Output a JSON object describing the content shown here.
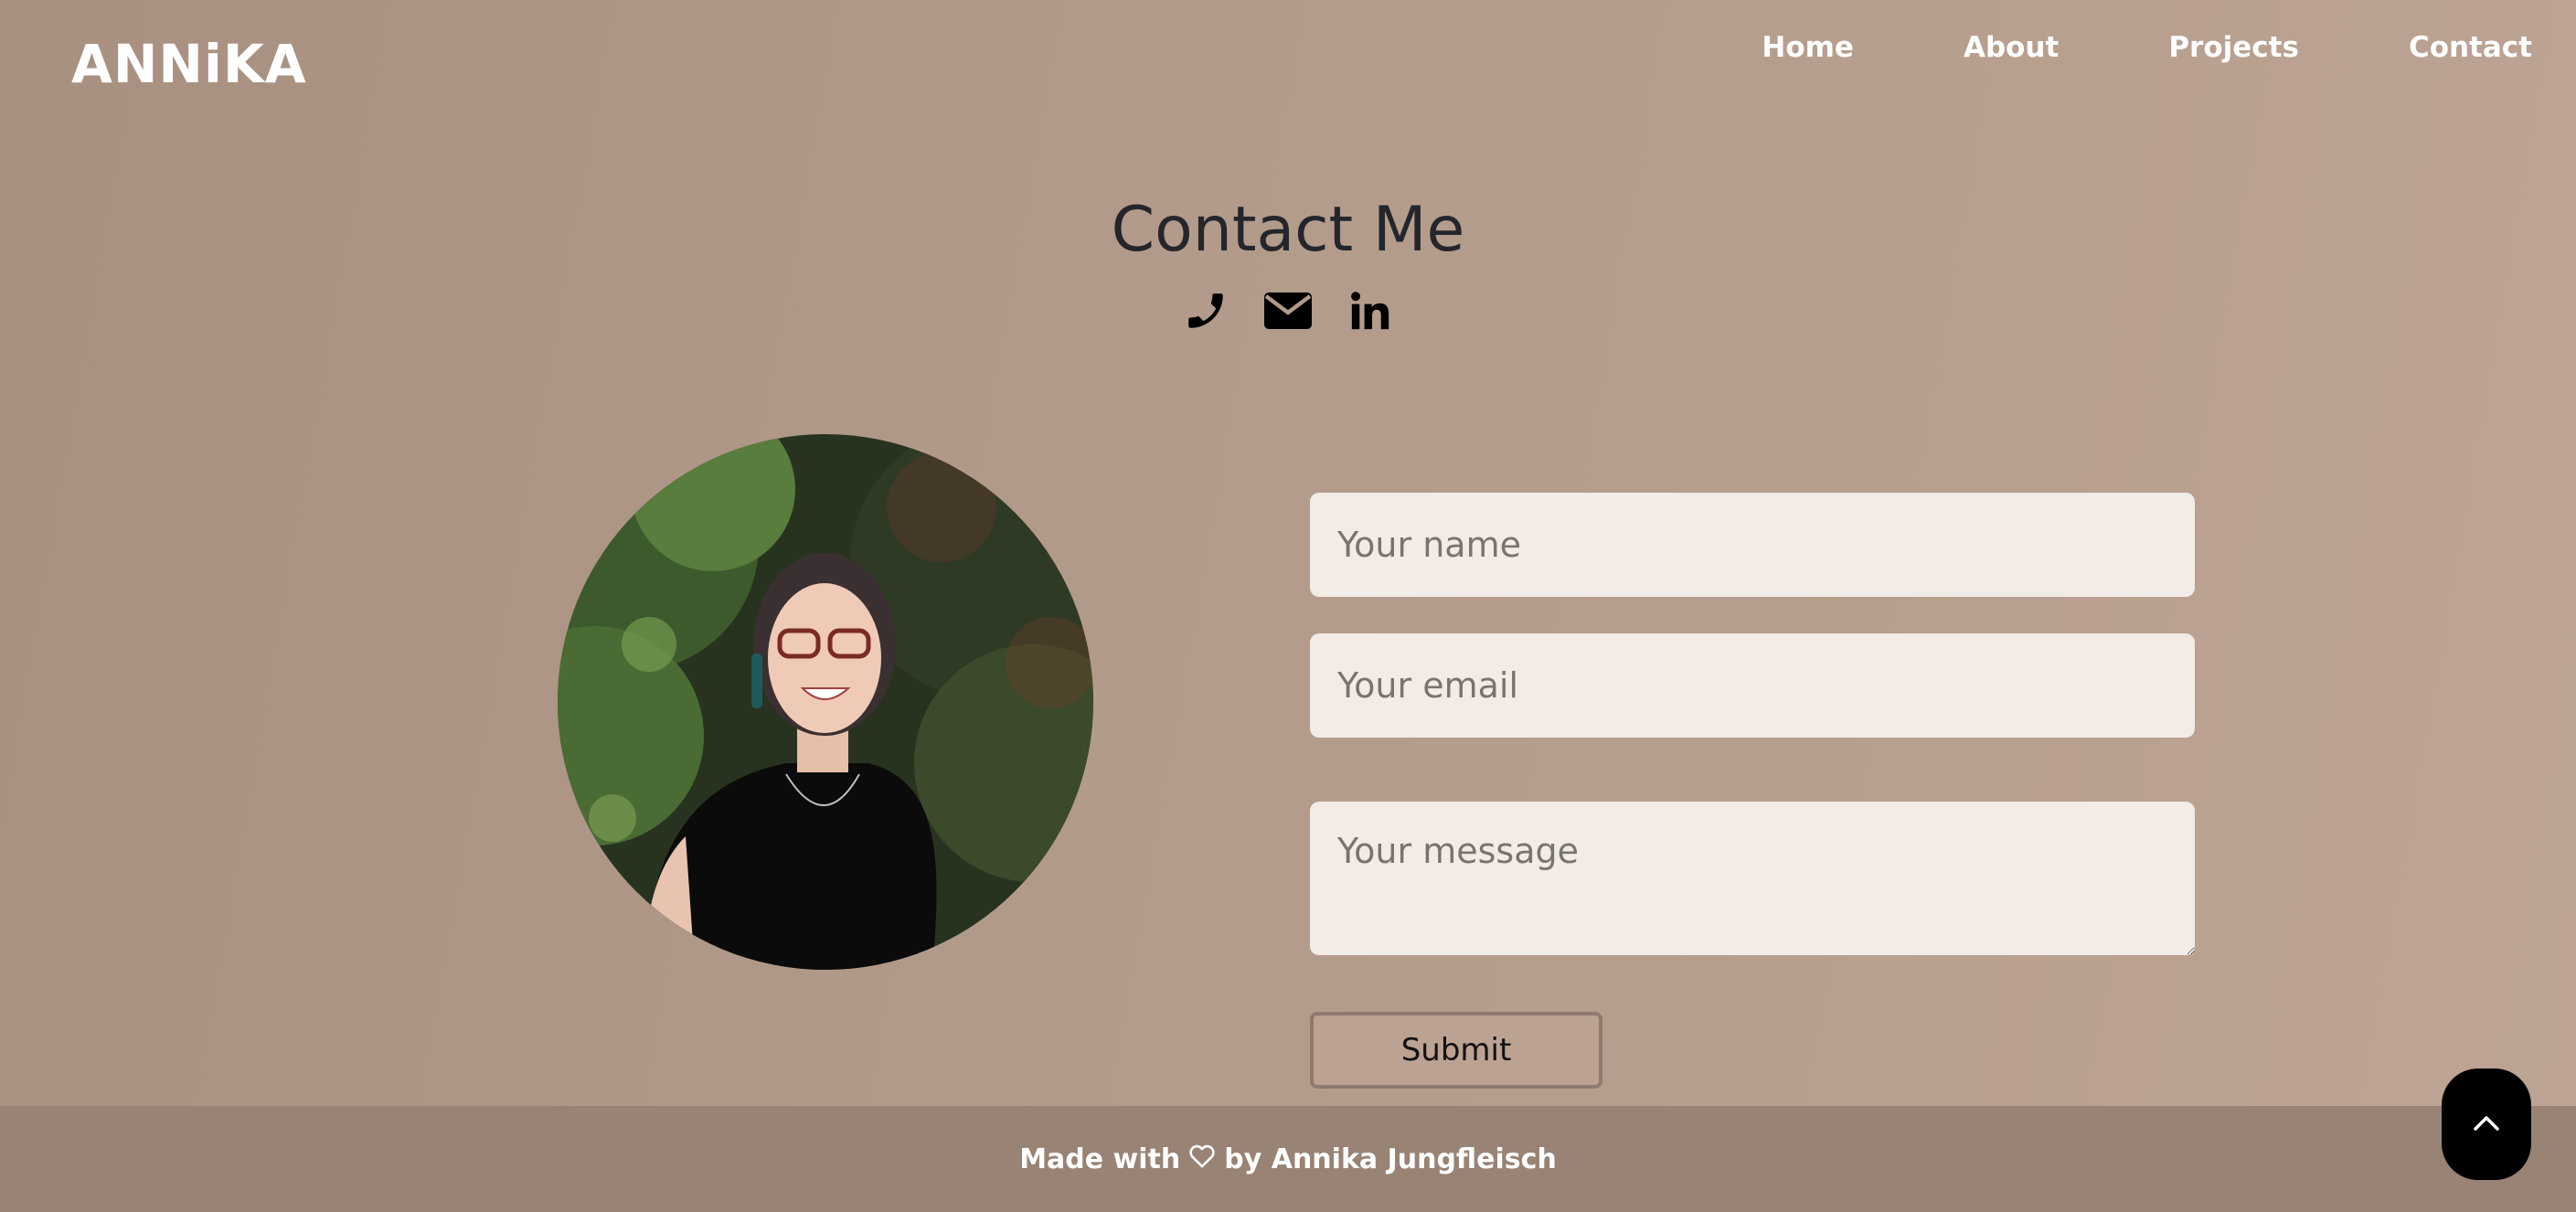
{
  "header": {
    "logo": "ANNiKA",
    "nav": [
      "Home",
      "About",
      "Projects",
      "Contact"
    ]
  },
  "contact": {
    "title": "Contact Me",
    "icons": [
      "phone-icon",
      "envelope-icon",
      "linkedin-icon"
    ]
  },
  "form": {
    "name_placeholder": "Your name",
    "email_placeholder": "Your email",
    "message_placeholder": "Your message",
    "submit_label": "Submit"
  },
  "footer": {
    "prefix": "Made with",
    "suffix": "by Annika Jungfleisch",
    "icon": "heart-icon"
  },
  "back_to_top": {
    "icon": "chevron-up-icon"
  },
  "colors": {
    "background": "#b29b8a",
    "footer": "#988374",
    "input_bg": "#f2ebe6",
    "title": "#24262b"
  }
}
